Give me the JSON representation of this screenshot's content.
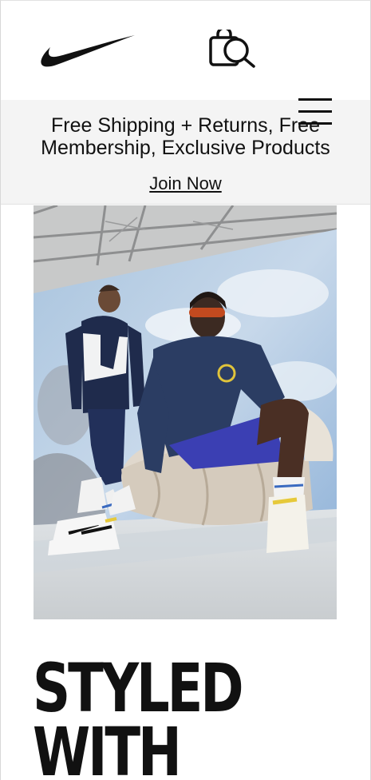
{
  "header": {
    "logo_icon": "nike-swoosh-icon",
    "bag_icon": "shopping-bag-search-icon",
    "menu_icon": "hamburger-menu-icon"
  },
  "promo": {
    "text": "Free Shipping + Returns, Free Membership, Exclusive Products",
    "link_label": "Join Now"
  },
  "hero": {
    "image": "hero-photo"
  },
  "headline": {
    "line1": "STYLED",
    "line2": "WITH"
  },
  "colors": {
    "text": "#111111",
    "promo_bg": "#f4f4f4",
    "background": "#ffffff"
  }
}
